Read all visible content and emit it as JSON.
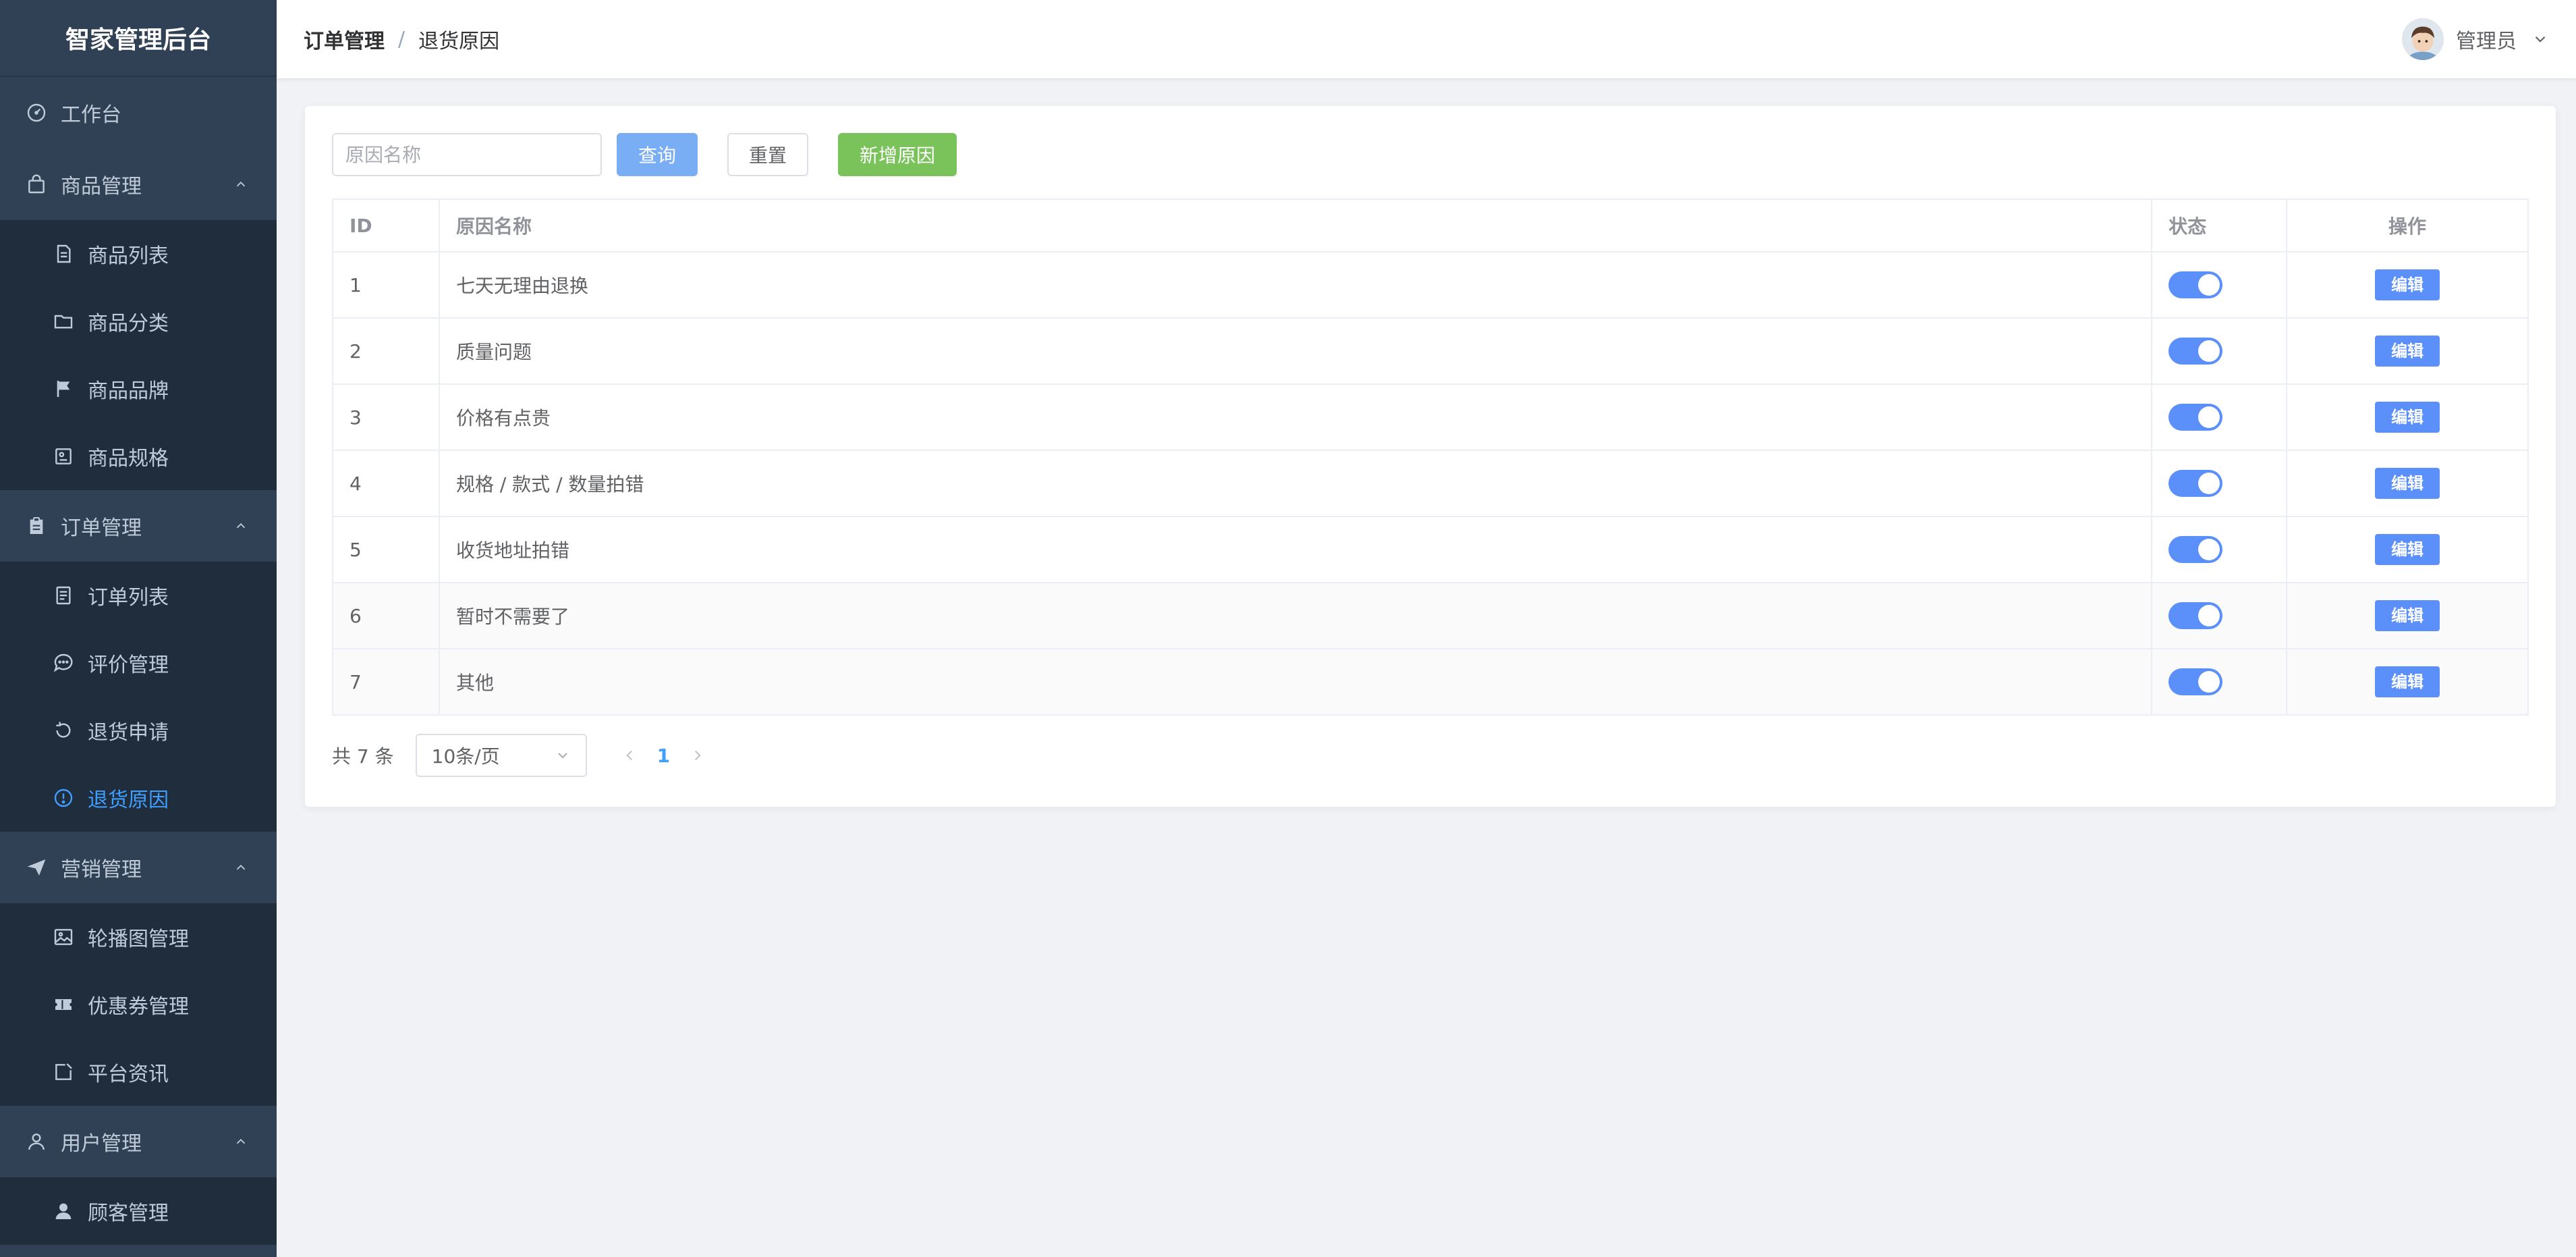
{
  "app": {
    "brand": "智家管理后台"
  },
  "header": {
    "breadcrumb": [
      "订单管理",
      "退货原因"
    ],
    "breadcrumb_sep": "/",
    "user_name": "管理员"
  },
  "sidebar": {
    "dashboard": {
      "label": "工作台",
      "icon": "dashboard-icon"
    },
    "goods": {
      "label": "商品管理",
      "icon": "bag-icon",
      "items": [
        {
          "label": "商品列表",
          "icon": "document-icon"
        },
        {
          "label": "商品分类",
          "icon": "folder-icon"
        },
        {
          "label": "商品品牌",
          "icon": "flag-icon"
        },
        {
          "label": "商品规格",
          "icon": "spec-icon"
        }
      ]
    },
    "orders": {
      "label": "订单管理",
      "icon": "clipboard-icon",
      "items": [
        {
          "label": "订单列表",
          "icon": "list-icon"
        },
        {
          "label": "评价管理",
          "icon": "chat-icon"
        },
        {
          "label": "退货申请",
          "icon": "refresh-icon"
        },
        {
          "label": "退货原因",
          "icon": "warning-circle-icon",
          "active": true
        }
      ]
    },
    "marketing": {
      "label": "营销管理",
      "icon": "send-icon",
      "items": [
        {
          "label": "轮播图管理",
          "icon": "picture-icon"
        },
        {
          "label": "优惠券管理",
          "icon": "ticket-icon"
        },
        {
          "label": "平台资讯",
          "icon": "news-icon"
        }
      ]
    },
    "users": {
      "label": "用户管理",
      "icon": "user-icon",
      "items": [
        {
          "label": "顾客管理",
          "icon": "user-filled-icon"
        }
      ]
    }
  },
  "toolbar": {
    "search_placeholder": "原因名称",
    "search_value": "",
    "query_label": "查询",
    "reset_label": "重置",
    "add_label": "新增原因"
  },
  "table": {
    "headers": {
      "id": "ID",
      "name": "原因名称",
      "status": "状态",
      "op": "操作"
    },
    "edit_label": "编辑",
    "rows": [
      {
        "id": "1",
        "name": "七天无理由退换",
        "enabled": true
      },
      {
        "id": "2",
        "name": "质量问题",
        "enabled": true
      },
      {
        "id": "3",
        "name": "价格有点贵",
        "enabled": true
      },
      {
        "id": "4",
        "name": "规格 / 款式 / 数量拍错",
        "enabled": true
      },
      {
        "id": "5",
        "name": "收货地址拍错",
        "enabled": true
      },
      {
        "id": "6",
        "name": "暂时不需要了",
        "enabled": true
      },
      {
        "id": "7",
        "name": "其他",
        "enabled": true
      }
    ]
  },
  "pagination": {
    "total_text": "共 7 条",
    "page_size": "10条/页",
    "current_page": "1"
  },
  "colors": {
    "sidebar_bg": "#304156",
    "active": "#409eff",
    "primary": "#5b8ff9",
    "success": "#7ac25a"
  }
}
